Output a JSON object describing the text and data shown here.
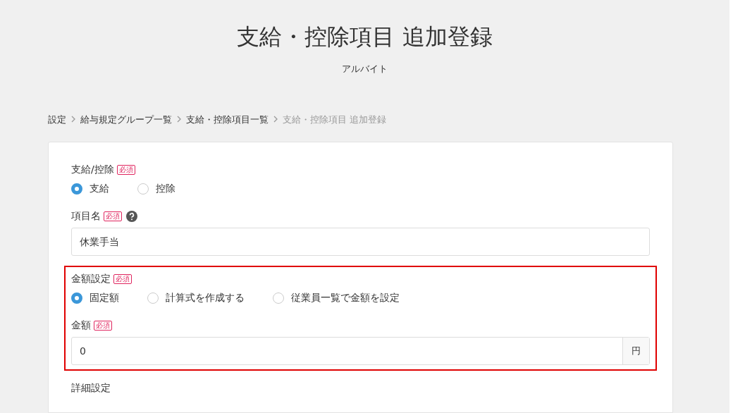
{
  "title": "支給・控除項目 追加登録",
  "subtitle": "アルバイト",
  "breadcrumb": [
    {
      "label": "設定",
      "current": false
    },
    {
      "label": "給与規定グループ一覧",
      "current": false
    },
    {
      "label": "支給・控除項目一覧",
      "current": false
    },
    {
      "label": "支給・控除項目 追加登録",
      "current": true
    }
  ],
  "sections": [
    {
      "highlighted": false,
      "fields": [
        {
          "kind": "radio",
          "label": "支給/控除",
          "badge": "必須",
          "help": false,
          "options": [
            {
              "label": "支給",
              "selected": true
            },
            {
              "label": "控除",
              "selected": false
            }
          ]
        },
        {
          "kind": "text",
          "label": "項目名",
          "badge": "必須",
          "help": true,
          "value": "休業手当"
        }
      ]
    },
    {
      "highlighted": true,
      "fields": [
        {
          "kind": "radio",
          "label": "金額設定",
          "badge": "必須",
          "help": false,
          "options": [
            {
              "label": "固定額",
              "selected": true
            },
            {
              "label": "計算式を作成する",
              "selected": false
            },
            {
              "label": "従業員一覧で金額を設定",
              "selected": false
            }
          ]
        },
        {
          "kind": "amount",
          "label": "金額",
          "badge": "必須",
          "help": false,
          "value": "0",
          "unit": "円"
        }
      ]
    },
    {
      "highlighted": false,
      "fields": [
        {
          "kind": "heading",
          "label": "詳細設定"
        }
      ]
    }
  ]
}
